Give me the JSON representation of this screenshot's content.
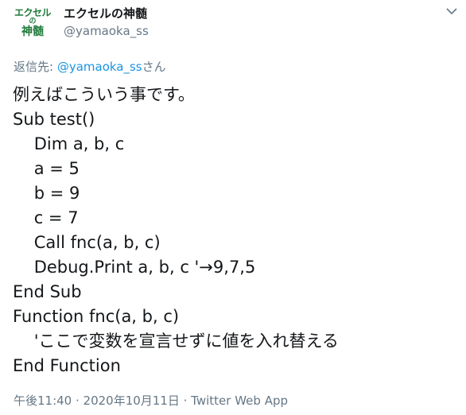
{
  "account": {
    "avatar_line1": "エクセル",
    "avatar_line2": "の",
    "avatar_line3": "神髄",
    "display_name": "エクセルの神髄",
    "handle": "@yamaoka_ss"
  },
  "reply_to": {
    "prefix": "返信先: ",
    "mention": "@yamaoka_ss",
    "suffix": "さん"
  },
  "tweet": {
    "lines": [
      "例えばこういう事です。",
      "Sub test()",
      "    Dim a, b, c",
      "    a = 5",
      "    b = 9",
      "    c = 7",
      "    Call fnc(a, b, c)",
      "    Debug.Print a, b, c '→9,7,5",
      "End Sub",
      "Function fnc(a, b, c)",
      "    'ここで変数を宣言せずに値を入れ替える",
      "End Function"
    ]
  },
  "meta": {
    "timestamp": "午後11:40 · 2020年10月11日 · Twitter Web App"
  },
  "icons": {
    "more": "chevron-down-icon"
  }
}
